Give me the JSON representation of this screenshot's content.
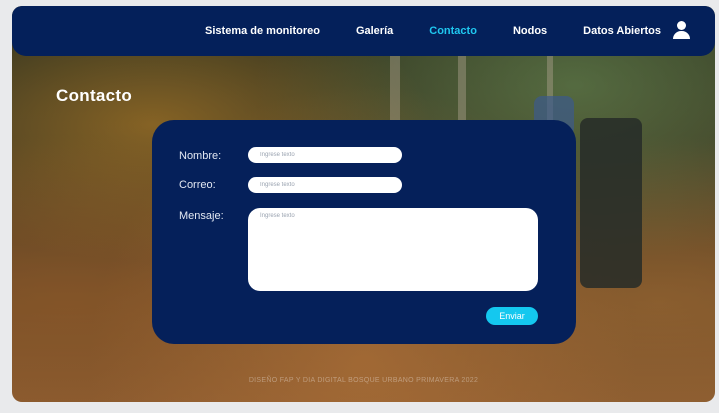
{
  "nav": {
    "items": [
      {
        "label": "Sistema de monitoreo",
        "active": false
      },
      {
        "label": "Galería",
        "active": false
      },
      {
        "label": "Contacto",
        "active": true
      },
      {
        "label": "Nodos",
        "active": false
      },
      {
        "label": "Datos Abiertos",
        "active": false
      }
    ],
    "user_icon": "user-icon"
  },
  "page": {
    "title": "Contacto"
  },
  "form": {
    "name_label": "Nombre:",
    "name_placeholder": "Ingrese texto",
    "email_label": "Correo:",
    "email_placeholder": "Ingrese texto",
    "message_label": "Mensaje:",
    "message_placeholder": "Ingrese texto",
    "submit_label": "Enviar"
  },
  "footer": {
    "text": "DISEÑO FAP Y DIA DIGITAL BOSQUE URBANO PRIMAVERA 2022"
  },
  "colors": {
    "navbar": "#04205a",
    "active": "#1fc7ef",
    "card": "#05205a",
    "button": "#14c8ef"
  }
}
